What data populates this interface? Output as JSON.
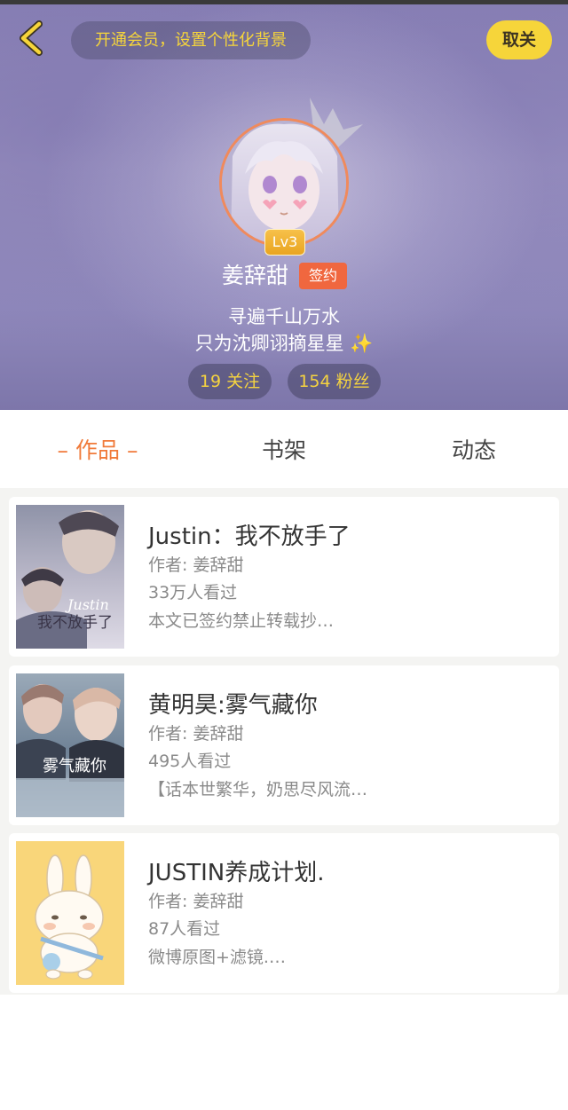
{
  "header": {
    "promo": "开通会员，设置个性化背景",
    "unfollow": "取关",
    "level": "Lv3",
    "name": "姜辞甜",
    "sign_badge": "签约",
    "bio_line1": "寻遍千山万水",
    "bio_line2": "只为沈卿诩摘星星",
    "following": "19 关注",
    "fans": "154 粉丝"
  },
  "tabs": {
    "works": "– 作品 –",
    "shelf": "书架",
    "feed": "动态"
  },
  "books": [
    {
      "title": "Justin：我不放手了",
      "author": "作者: 姜辞甜",
      "views": "33万人看过",
      "desc": "本文已签约禁止转载抄…",
      "cover_text": "我不放手了",
      "cover_sub": "Justin"
    },
    {
      "title": "黄明昊:雾气藏你",
      "author": "作者: 姜辞甜",
      "views": "495人看过",
      "desc": "【话本世繁华，奶思尽风流…",
      "cover_text": "雾气藏你"
    },
    {
      "title": "JUSTIN养成计划.",
      "author": "作者: 姜辞甜",
      "views": "87人看过",
      "desc": "微博原图+滤镜.…"
    }
  ],
  "colors": {
    "accent": "#f07a3a",
    "yellow": "#f6d53a",
    "header_purple": "#938bbd",
    "badge_red": "#f0673f"
  }
}
